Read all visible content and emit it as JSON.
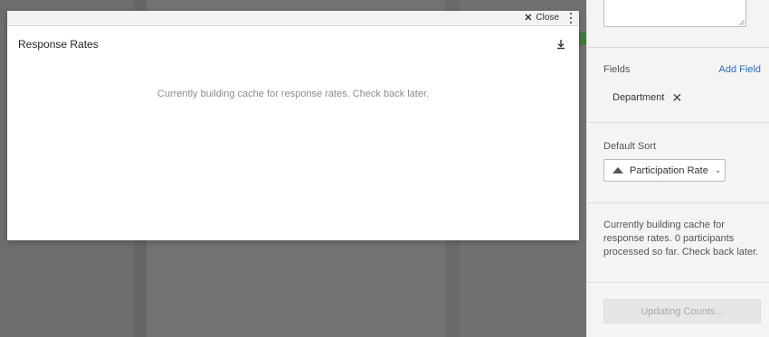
{
  "modal": {
    "close_label": "Close",
    "title": "Response Rates",
    "message": "Currently building cache for response rates. Check back later."
  },
  "panel": {
    "fields_label": "Fields",
    "add_field_label": "Add Field",
    "field_chips": [
      "Department"
    ],
    "default_sort_label": "Default Sort",
    "default_sort_value": "Participation Rate",
    "status_message": "Currently building cache for response rates. 0 participants processed so far. Check back later.",
    "update_button_label": "Updating Counts..."
  },
  "colors": {
    "link": "#2d6cb7",
    "overlay": "#6e6e6e"
  }
}
